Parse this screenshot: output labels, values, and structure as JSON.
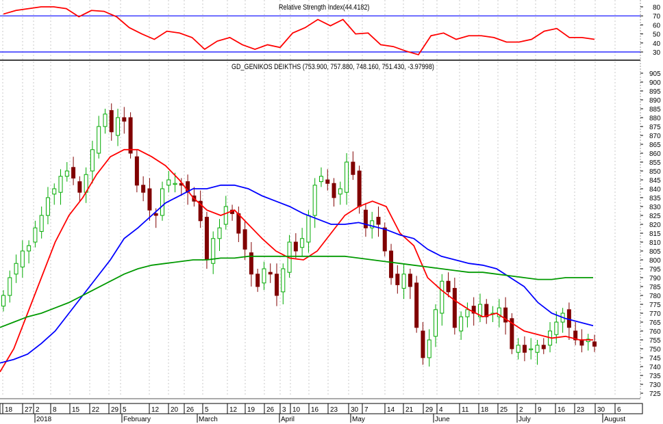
{
  "chart_data": [
    {
      "type": "line",
      "title": "Relative Strength Index(44.4182)",
      "ylim": [
        20,
        85
      ],
      "yticks": [
        80,
        70,
        60,
        50,
        40,
        30
      ],
      "reference_lines": [
        70,
        30
      ],
      "colors": {
        "rsi": "#ff0000",
        "reference": "#0000ff"
      },
      "values": [
        72,
        76,
        78,
        80,
        80,
        78,
        69,
        76,
        75,
        69,
        57,
        50,
        44,
        53,
        51,
        46,
        33,
        42,
        46,
        38,
        33,
        38,
        35,
        51,
        57,
        66,
        59,
        66,
        50,
        51,
        38,
        36,
        31,
        27,
        48,
        51,
        44,
        48,
        48,
        46,
        41,
        41,
        44,
        53,
        56,
        46,
        46,
        44
      ]
    },
    {
      "type": "candlestick",
      "title": "GD_GENIKOS DEIKTHS (753.900, 757.880, 748.160, 751.430, -3.97998)",
      "last_bar": {
        "open": 753.9,
        "high": 757.88,
        "low": 748.16,
        "close": 751.43,
        "change": -3.97998
      },
      "ylim": [
        722,
        908
      ],
      "yticks": [
        905,
        900,
        895,
        890,
        885,
        880,
        875,
        870,
        865,
        860,
        855,
        850,
        845,
        840,
        835,
        830,
        825,
        820,
        815,
        810,
        805,
        800,
        795,
        790,
        785,
        780,
        775,
        770,
        765,
        760,
        755,
        750,
        745,
        740,
        735,
        730,
        725
      ],
      "closes": [
        780,
        790,
        798,
        805,
        808,
        818,
        825,
        835,
        840,
        847,
        850,
        846,
        838,
        848,
        862,
        875,
        882,
        872,
        880,
        878,
        860,
        842,
        838,
        828,
        825,
        840,
        845,
        843,
        842,
        838,
        833,
        822,
        800,
        812,
        818,
        830,
        826,
        815,
        806,
        792,
        785,
        795,
        792,
        780,
        795,
        810,
        805,
        812,
        825,
        842,
        847,
        843,
        835,
        840,
        855,
        848,
        830,
        818,
        822,
        820,
        805,
        790,
        786,
        792,
        785,
        762,
        745,
        755,
        772,
        788,
        782,
        762,
        768,
        772,
        770,
        775,
        768,
        770,
        773,
        765,
        750,
        752,
        748,
        750,
        752,
        750,
        760,
        765,
        770,
        762,
        755,
        752,
        755.41,
        751.43
      ],
      "moving_averages": [
        {
          "name": "short",
          "color": "#ff0000",
          "values": [
            737,
            750,
            770,
            790,
            810,
            825,
            835,
            848,
            858,
            862,
            862,
            858,
            853,
            845,
            835,
            828,
            825,
            828,
            820,
            812,
            805,
            801,
            800,
            805,
            815,
            825,
            830,
            833,
            830,
            815,
            808,
            790,
            783,
            777,
            772,
            768,
            770,
            765,
            760,
            758,
            756,
            757,
            755,
            755
          ]
        },
        {
          "name": "medium",
          "color": "#0000ff",
          "values": [
            742,
            744,
            747,
            753,
            760,
            770,
            780,
            790,
            800,
            812,
            818,
            825,
            832,
            836,
            840,
            840,
            842,
            842,
            840,
            836,
            833,
            830,
            826,
            823,
            820,
            820,
            821,
            819,
            817,
            814,
            812,
            806,
            802,
            800,
            798,
            797,
            795,
            790,
            785,
            776,
            770,
            767,
            765,
            763
          ]
        },
        {
          "name": "long",
          "color": "#009900",
          "values": [
            762,
            765,
            768,
            770,
            773,
            776,
            780,
            784,
            788,
            792,
            795,
            797,
            798,
            799,
            800,
            800,
            801,
            801,
            802,
            802,
            802,
            802,
            802,
            802,
            802,
            802,
            801,
            800,
            799,
            798,
            797,
            796,
            795,
            794,
            793,
            793,
            792,
            791,
            790,
            789,
            789,
            790,
            790,
            790
          ]
        }
      ],
      "x_week_labels": [
        "18",
        "27",
        "2",
        "8",
        "15",
        "22",
        "29",
        "5",
        "12",
        "20",
        "26",
        "5",
        "12",
        "19",
        "26",
        "3",
        "10",
        "16",
        "23",
        "30",
        "7",
        "14",
        "21",
        "29",
        "4",
        "11",
        "18",
        "25",
        "2",
        "9",
        "16",
        "23",
        "30",
        "6"
      ],
      "x_month_labels": [
        "2018",
        "February",
        "March",
        "April",
        "May",
        "June",
        "July",
        "August"
      ],
      "colors": {
        "up": "#00aa00",
        "down": "#800000"
      }
    }
  ]
}
